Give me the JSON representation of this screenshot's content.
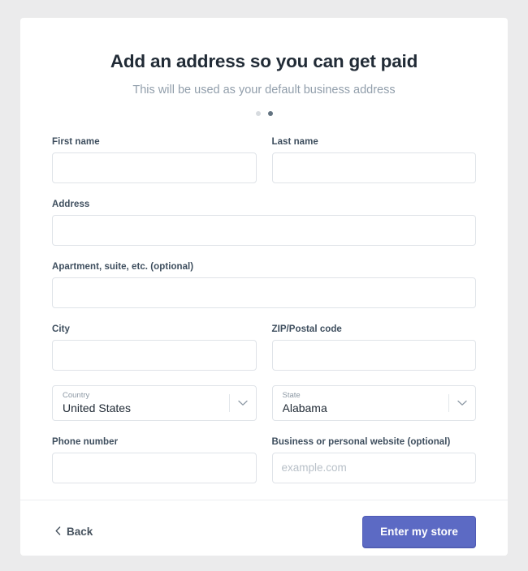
{
  "header": {
    "title": "Add an address so you can get paid",
    "subtitle": "This will be used as your default business address"
  },
  "progress": {
    "total_steps": 2,
    "active_step": 2
  },
  "form": {
    "first_name": {
      "label": "First name",
      "value": "",
      "placeholder": ""
    },
    "last_name": {
      "label": "Last name",
      "value": "",
      "placeholder": ""
    },
    "address": {
      "label": "Address",
      "value": "",
      "placeholder": ""
    },
    "apartment": {
      "label": "Apartment, suite, etc. (optional)",
      "value": "",
      "placeholder": ""
    },
    "city": {
      "label": "City",
      "value": "",
      "placeholder": ""
    },
    "zip": {
      "label": "ZIP/Postal code",
      "value": "",
      "placeholder": ""
    },
    "country": {
      "label": "Country",
      "value": "United States"
    },
    "state": {
      "label": "State",
      "value": "Alabama"
    },
    "phone": {
      "label": "Phone number",
      "value": "",
      "placeholder": ""
    },
    "website": {
      "label": "Business or personal website (optional)",
      "value": "",
      "placeholder": "example.com"
    }
  },
  "footer": {
    "back_label": "Back",
    "submit_label": "Enter my store"
  },
  "icons": {
    "chevron_left": "‹",
    "chevron_down": "chevron-down-icon"
  },
  "colors": {
    "primary": "#5c6ac4",
    "page_background": "#ebebec",
    "card_background": "#ffffff",
    "label_text": "#3e4e5e",
    "subtitle_text": "#919eab",
    "input_border": "#dfe3e8",
    "dot_active": "#637381",
    "dot_inactive": "#d7dbdf"
  }
}
